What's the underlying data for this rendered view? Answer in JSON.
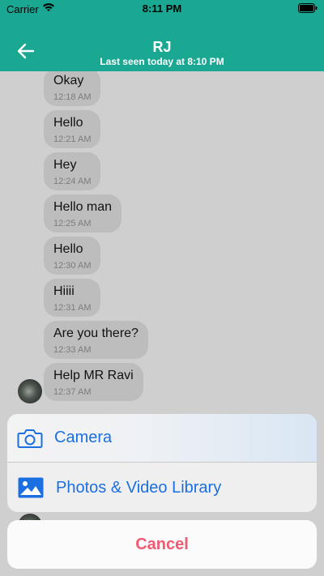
{
  "status_bar": {
    "carrier": "Carrier",
    "time": "8:11 PM"
  },
  "header": {
    "title": "RJ",
    "subtitle": "Last seen today at 8:10 PM"
  },
  "messages": [
    {
      "text": "Okay",
      "time": "12:18 AM"
    },
    {
      "text": "Hello",
      "time": "12:21 AM"
    },
    {
      "text": "Hey",
      "time": "12:24 AM"
    },
    {
      "text": "Hello man",
      "time": "12:25 AM"
    },
    {
      "text": "Hello",
      "time": "12:30 AM"
    },
    {
      "text": "Hiiii",
      "time": "12:31 AM"
    },
    {
      "text": "Are you there?",
      "time": "12:33 AM"
    },
    {
      "text": "Help MR Ravi",
      "time": "12:37 AM"
    }
  ],
  "action_sheet": {
    "options": [
      {
        "label": "Camera",
        "icon": "camera-icon"
      },
      {
        "label": "Photos & Video Library",
        "icon": "photo-library-icon"
      }
    ],
    "cancel_label": "Cancel"
  },
  "colors": {
    "header": "#1aa893",
    "action_text": "#1b6fe0",
    "cancel_text": "#f05a73"
  }
}
